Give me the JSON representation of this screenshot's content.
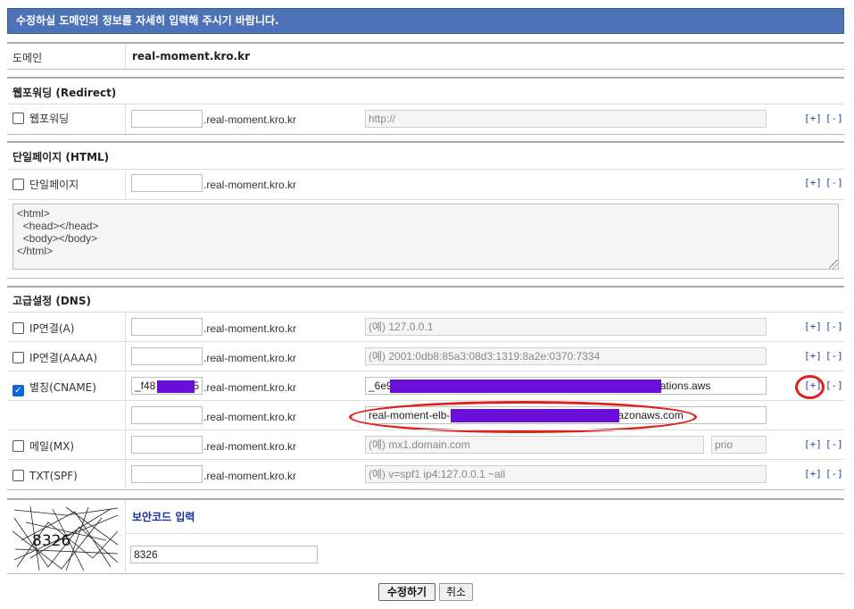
{
  "banner": {
    "text": "수정하실 도메인의 정보를 자세히 입력해 주시기 바랍니다."
  },
  "domain": {
    "label": "도메인",
    "value": "real-moment.kro.kr"
  },
  "suffix": ".real-moment.kro.kr",
  "controls": {
    "plus": "[+]",
    "minus": "[-]"
  },
  "redirect": {
    "title": "웹포워딩 (Redirect)",
    "row": {
      "label": "웹포워딩",
      "checked": false,
      "host_value": "",
      "url_placeholder": "http://"
    }
  },
  "html_page": {
    "title": "단일페이지 (HTML)",
    "row": {
      "label": "단일페이지",
      "checked": false,
      "host_value": ""
    },
    "textarea": "<html>\n  <head></head>\n  <body></body>\n</html>"
  },
  "dns": {
    "title": "고급설정 (DNS)",
    "rows": [
      {
        "label": "IP연결(A)",
        "checked": false,
        "host_value": "",
        "value_placeholder": "(예) 127.0.0.1"
      },
      {
        "label": "IP연결(AAAA)",
        "checked": false,
        "host_value": "",
        "value_placeholder": "(예) 2001:0db8:85a3:08d3:1319:8a2e:0370:7334"
      },
      {
        "label": "별칭(CNAME)",
        "checked": true,
        "host_value_prefix": "_f48",
        "host_value_suffix": "5",
        "value_prefix": "_6e9",
        "value_suffix": "ations.aws"
      },
      {
        "label": "",
        "checked": false,
        "host_value": "",
        "value_prefix": "real-moment-elb-",
        "value_suffix": "azonaws.com"
      },
      {
        "label": "메일(MX)",
        "checked": false,
        "host_value": "",
        "value_placeholder": "(예) mx1.domain.com",
        "prio_placeholder": "prio"
      },
      {
        "label": "TXT(SPF)",
        "checked": false,
        "host_value": "",
        "value_placeholder": "(예) v=spf1 ip4:127.0.0.1 ~all"
      }
    ]
  },
  "captcha": {
    "title": "보안코드 입력",
    "image_text": "8326",
    "input_value": "8326"
  },
  "buttons": {
    "submit": "수정하기",
    "cancel": "취소"
  },
  "colors": {
    "banner": "#4d72b8",
    "redaction": "#6a0fd8",
    "annotation": "#e0201a",
    "link": "#2b3fa8"
  }
}
